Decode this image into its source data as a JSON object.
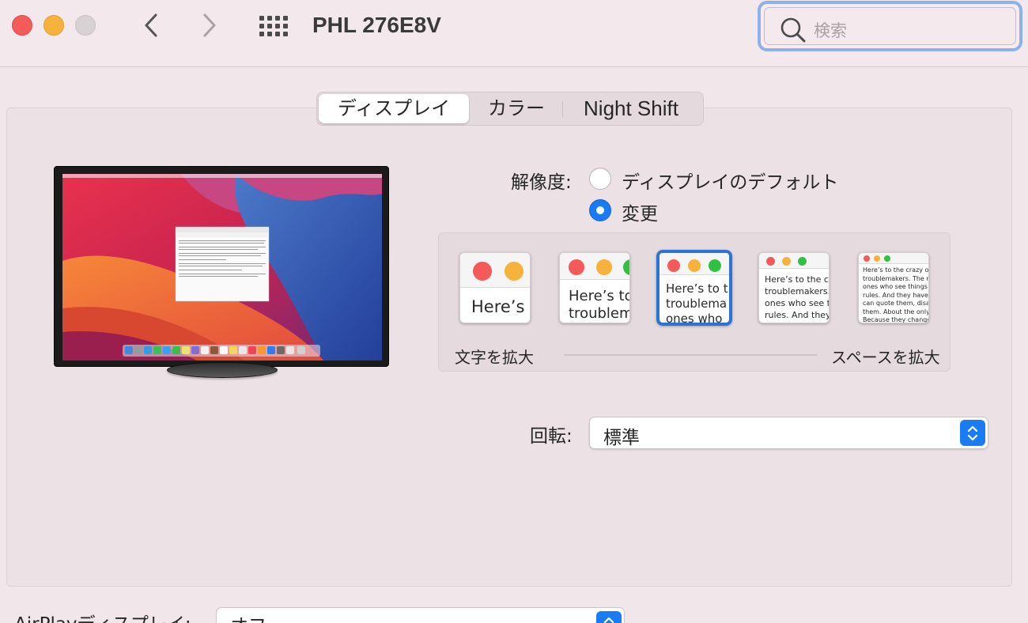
{
  "window": {
    "title": "PHL 276E8V"
  },
  "search": {
    "placeholder": "検索"
  },
  "tabs": [
    {
      "label": "ディスプレイ",
      "selected": true
    },
    {
      "label": "カラー",
      "selected": false
    },
    {
      "label": "Night Shift",
      "selected": false
    }
  ],
  "resolution": {
    "label": "解像度:",
    "options": [
      {
        "label": "ディスプレイのデフォルト",
        "selected": false
      },
      {
        "label": "変更",
        "selected": true
      }
    ],
    "scale": {
      "left_label": "文字を拡大",
      "right_label": "スペースを拡大",
      "selected_index": 2,
      "previews": [
        {
          "lines": [
            "Here’s"
          ]
        },
        {
          "lines": [
            "Here’s to",
            "troublem"
          ]
        },
        {
          "lines": [
            "Here’s to t",
            "troublema",
            "ones who"
          ]
        },
        {
          "lines": [
            "Here’s to the cr",
            "troublemakers.",
            "ones who see t",
            "rules. And they"
          ]
        },
        {
          "lines": [
            "Here’s to the crazy one",
            "troublemakers. The rou",
            "ones who see things dif",
            "rules. And they have no",
            "can quote them, disagre",
            "them. About the only th",
            "Because they change th"
          ]
        }
      ]
    }
  },
  "rotation": {
    "label": "回転:",
    "value": "標準"
  },
  "airplay": {
    "label": "AirPlayディスプレイ:",
    "value": "オフ"
  },
  "colors": {
    "accent": "#1a7cf5",
    "close": "#f35c5a",
    "minimize": "#f6b23c"
  }
}
